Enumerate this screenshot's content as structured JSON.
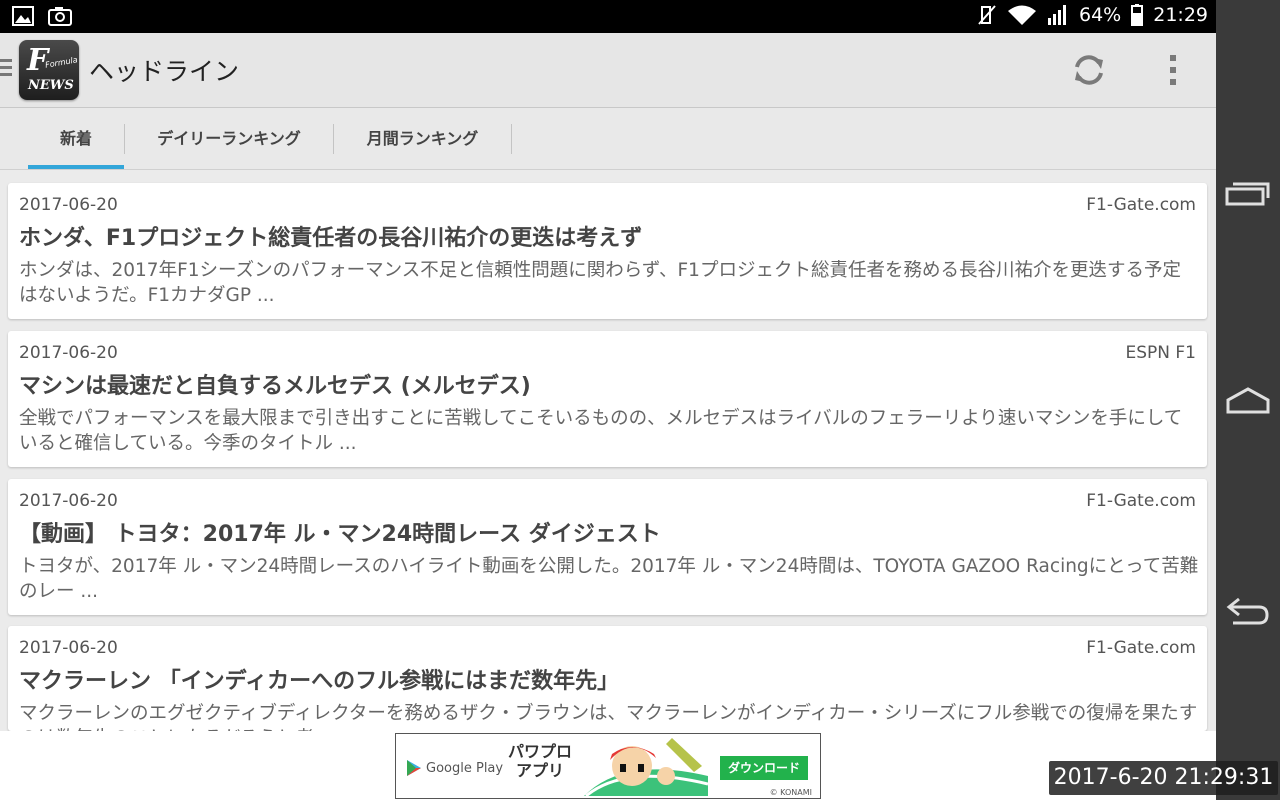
{
  "status_bar": {
    "battery": "64%",
    "time": "21:29"
  },
  "app_bar": {
    "logo_f": "F",
    "logo_formula": "Formula",
    "logo_news": "NEWS",
    "title": "ヘッドライン"
  },
  "tabs": [
    {
      "label": "新着",
      "active": true
    },
    {
      "label": "デイリーランキング",
      "active": false
    },
    {
      "label": "月間ランキング",
      "active": false
    }
  ],
  "articles": [
    {
      "date": "2017-06-20",
      "source": "F1-Gate.com",
      "title": "ホンダ、F1プロジェクト総責任者の長谷川祐介の更迭は考えず",
      "summary": "ホンダは、2017年F1シーズンのパフォーマンス不足と信頼性問題に関わらず、F1プロジェクト総責任者を務める長谷川祐介を更迭する予定はないようだ。F1カナダGP ..."
    },
    {
      "date": "2017-06-20",
      "source": "ESPN F1",
      "title": "マシンは最速だと自負するメルセデス (メルセデス)",
      "summary": "全戦でパフォーマンスを最大限まで引き出すことに苦戦してこそいるものの、メルセデスはライバルのフェラーリより速いマシンを手にしていると確信している。今季のタイトル ..."
    },
    {
      "date": "2017-06-20",
      "source": "F1-Gate.com",
      "title": "【動画】 トヨタ：2017年 ル・マン24時間レース ダイジェスト",
      "summary": "トヨタが、2017年 ル・マン24時間レースのハイライト動画を公開した。2017年 ル・マン24時間は、TOYOTA GAZOO Racingにとって苦難のレー ..."
    },
    {
      "date": "2017-06-20",
      "source": "F1-Gate.com",
      "title": "マクラーレン 「インディカーへのフル参戦にはまだ数年先」",
      "summary": "マクラーレンのエグゼクティブディレクターを務めるザク・ブラウンは、マクラーレンがインディカー・シリーズにフル参戦での復帰を果たすのは数年先のことになるだろうと考"
    }
  ],
  "ad": {
    "store": "Google Play",
    "line1": "パワプロ",
    "line2": "アプリ",
    "cta": "ダウンロード",
    "brand": "© KONAMI"
  },
  "overlay_timestamp": "2017-6-20 21:29:31",
  "colors": {
    "accent": "#33a6d9",
    "ad_cta": "#22b24c",
    "nav_bar": "#3a3a3a"
  }
}
